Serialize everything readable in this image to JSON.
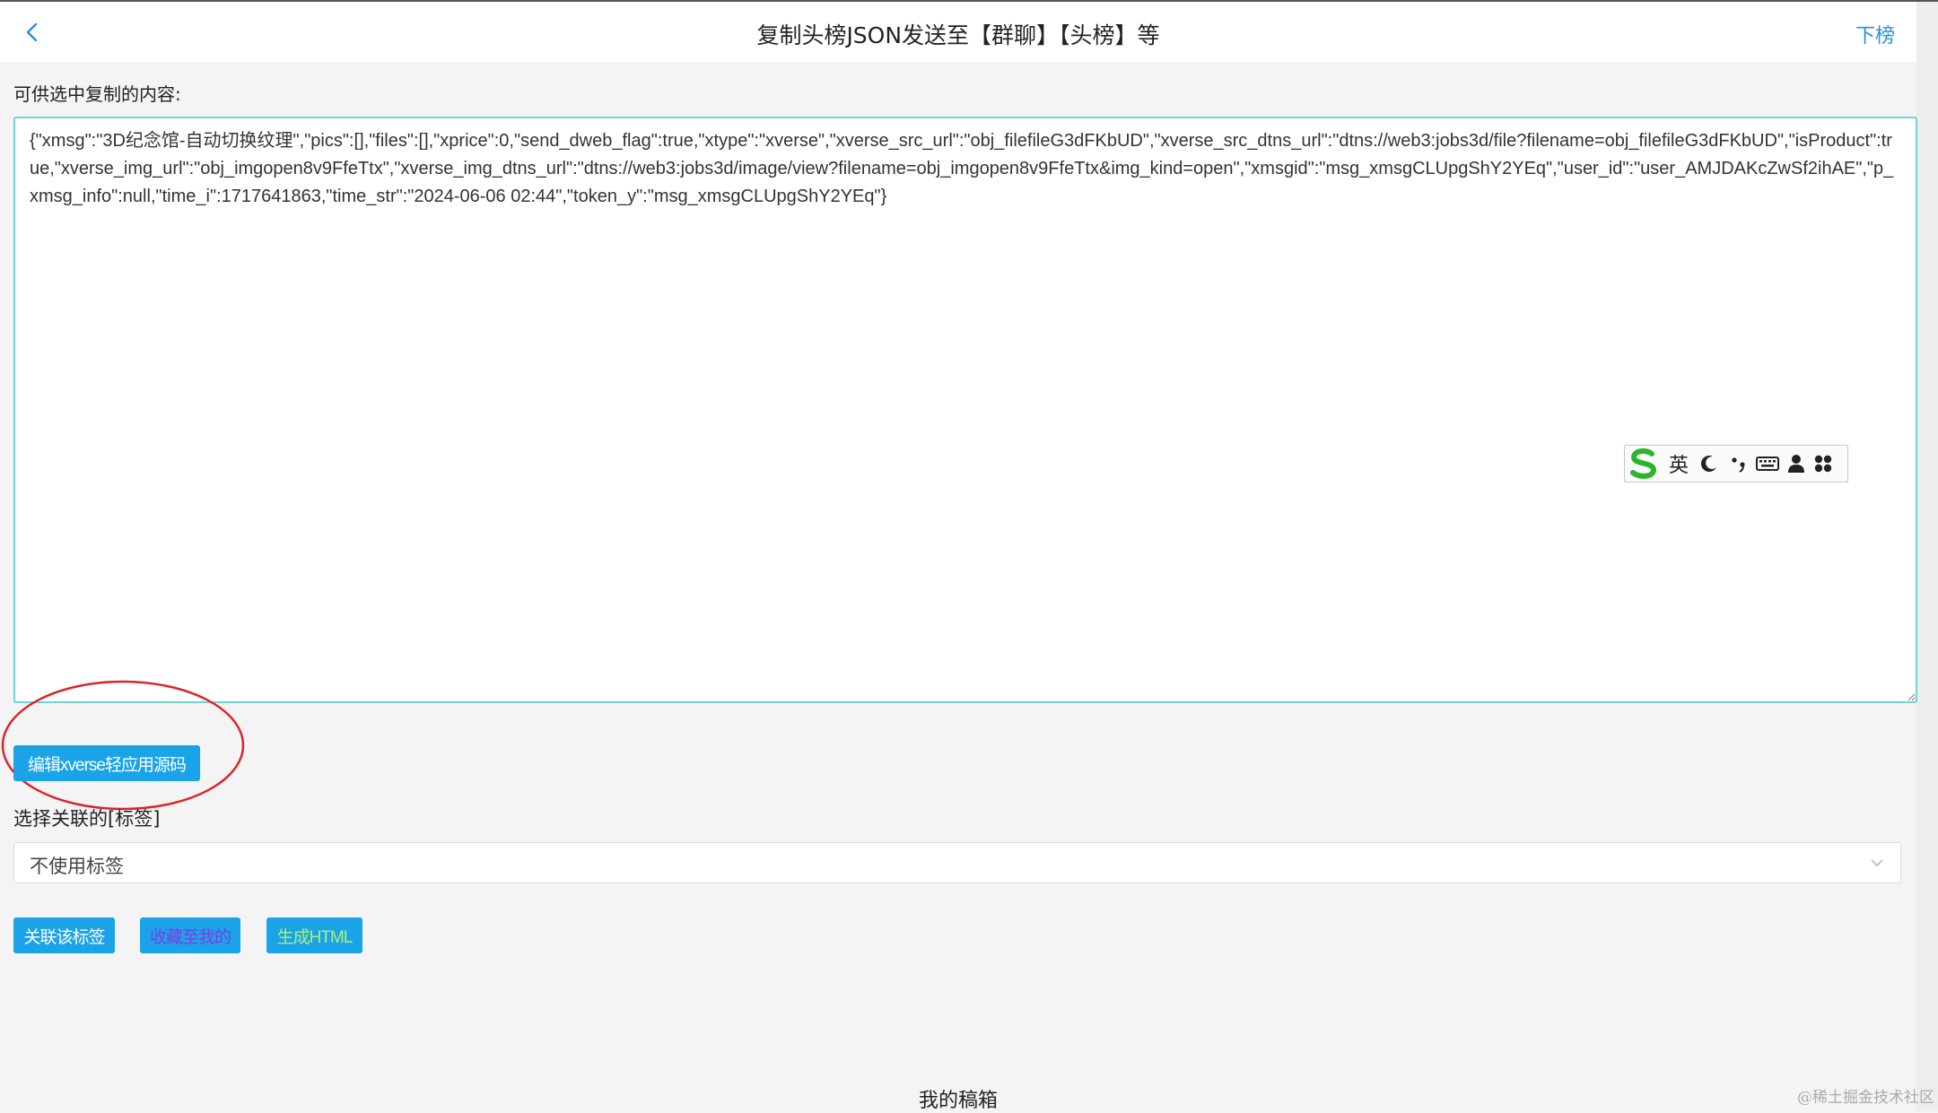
{
  "header": {
    "title": "复制头榜JSON发送至【群聊】【头榜】等",
    "back_icon": "chevron-left-icon",
    "next_label": "下榜"
  },
  "copy_section": {
    "label": "可供选中复制的内容:",
    "content": "{\"xmsg\":\"3D纪念馆-自动切换纹理\",\"pics\":[],\"files\":[],\"xprice\":0,\"send_dweb_flag\":true,\"xtype\":\"xverse\",\"xverse_src_url\":\"obj_filefileG3dFKbUD\",\"xverse_src_dtns_url\":\"dtns://web3:jobs3d/file?filename=obj_filefileG3dFKbUD\",\"isProduct\":true,\"xverse_img_url\":\"obj_imgopen8v9FfeTtx\",\"xverse_img_dtns_url\":\"dtns://web3:jobs3d/image/view?filename=obj_imgopen8v9FfeTtx&img_kind=open\",\"xmsgid\":\"msg_xmsgCLUpgShY2YEq\",\"user_id\":\"user_AMJDAKcZwSf2ihAE\",\"p_xmsg_info\":null,\"time_i\":1717641863,\"time_str\":\"2024-06-06 02:44\",\"token_y\":\"msg_xmsgCLUpgShY2YEq\"}"
  },
  "ime_toolbar": {
    "logo_icon": "sogou-s-icon",
    "lang_label": "英",
    "items": [
      "moon-icon",
      "punctuation-icon",
      "keyboard-icon",
      "user-icon",
      "grid-icon"
    ]
  },
  "edit_button": {
    "label": "编辑xverse轻应用源码"
  },
  "tag_section": {
    "label": "选择关联的[标签]",
    "selected": "不使用标签"
  },
  "actions": [
    {
      "label": "关联该标签",
      "color": "#ffffff"
    },
    {
      "label": "收藏至我的",
      "color": "#7b3fe4"
    },
    {
      "label": "生成HTML",
      "color": "#a8f07a"
    }
  ],
  "footer": {
    "label": "我的稿箱",
    "watermark": "@稀土掘金技术社区"
  },
  "colors": {
    "accent": "#1aa3e8",
    "link": "#2a8fd6",
    "annotation": "#d9262b",
    "textarea_border": "#6fd4d4"
  }
}
